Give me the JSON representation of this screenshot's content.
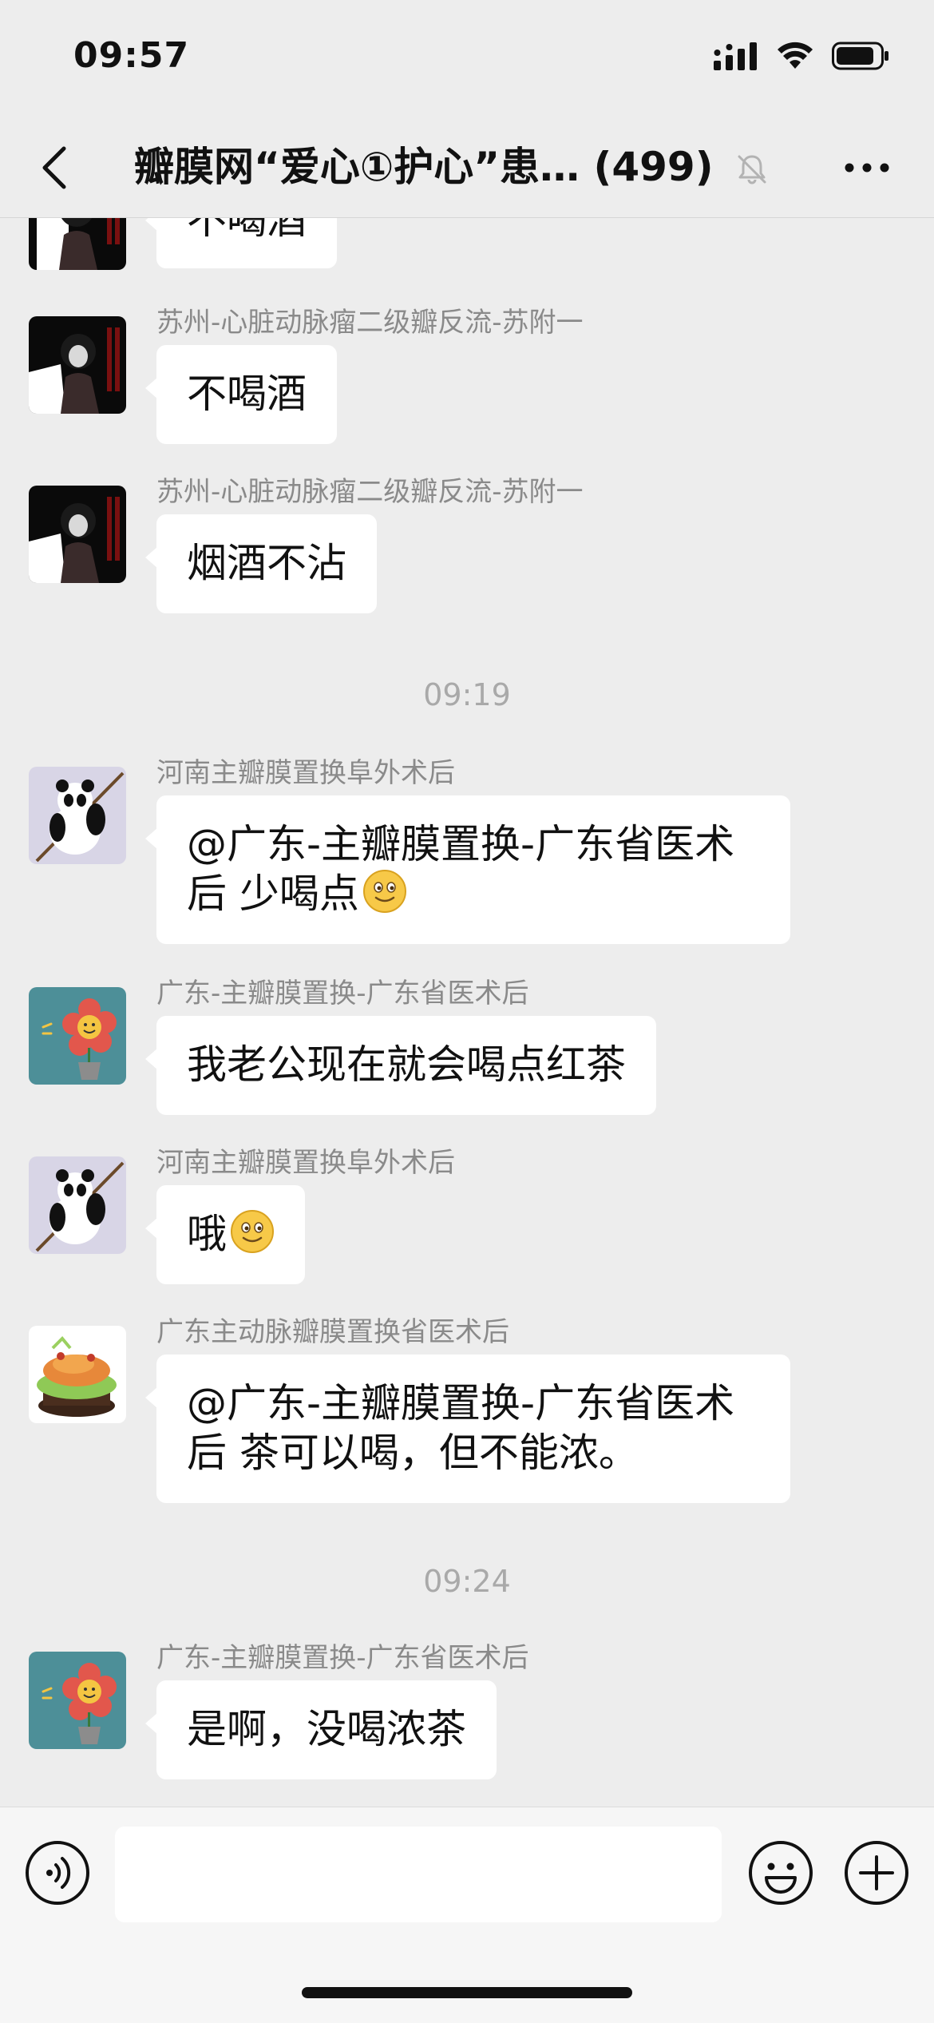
{
  "status_bar": {
    "time": "09:57"
  },
  "header": {
    "title": "瓣膜网“爱心①护心”患…",
    "member_count": "(499)"
  },
  "messages": [
    {
      "type": "message",
      "sender": "",
      "avatar": "dark-person-avatar",
      "text": "不喝酒"
    },
    {
      "type": "message",
      "sender": "苏州-心脏动脉瘤二级瓣反流-苏附一",
      "avatar": "dark-person-avatar",
      "text": "不喝酒"
    },
    {
      "type": "message",
      "sender": "苏州-心脏动脉瘤二级瓣反流-苏附一",
      "avatar": "dark-person-avatar",
      "text": "烟酒不沾"
    },
    {
      "type": "timestamp",
      "text": "09:19"
    },
    {
      "type": "message",
      "sender": "河南主瓣膜置换阜外术后",
      "avatar": "panda-avatar",
      "text_line1": "@广东-主瓣膜置换-广东省医术",
      "text_line2": "后 少喝点",
      "emoji": "smile"
    },
    {
      "type": "message",
      "sender": "广东-主瓣膜置换-广东省医术后",
      "avatar": "flower-avatar",
      "text": "我老公现在就会喝点红茶"
    },
    {
      "type": "message",
      "sender": "河南主瓣膜置换阜外术后",
      "avatar": "panda-avatar",
      "text": "哦",
      "emoji": "smile"
    },
    {
      "type": "message",
      "sender": "广东主动脉瓣膜置换省医术后",
      "avatar": "food-avatar",
      "text_line1": "@广东-主瓣膜置换-广东省医术",
      "text_line2": "后 茶可以喝，但不能浓。"
    },
    {
      "type": "timestamp",
      "text": "09:24"
    },
    {
      "type": "message",
      "sender": "广东-主瓣膜置换-广东省医术后",
      "avatar": "flower-avatar",
      "text": "是啊，没喝浓茶"
    }
  ],
  "input": {
    "value": ""
  },
  "colors": {
    "background": "#ededed",
    "bubble": "#ffffff",
    "sender_text": "#8a8a8a",
    "timestamp_text": "#a9a9a9"
  }
}
